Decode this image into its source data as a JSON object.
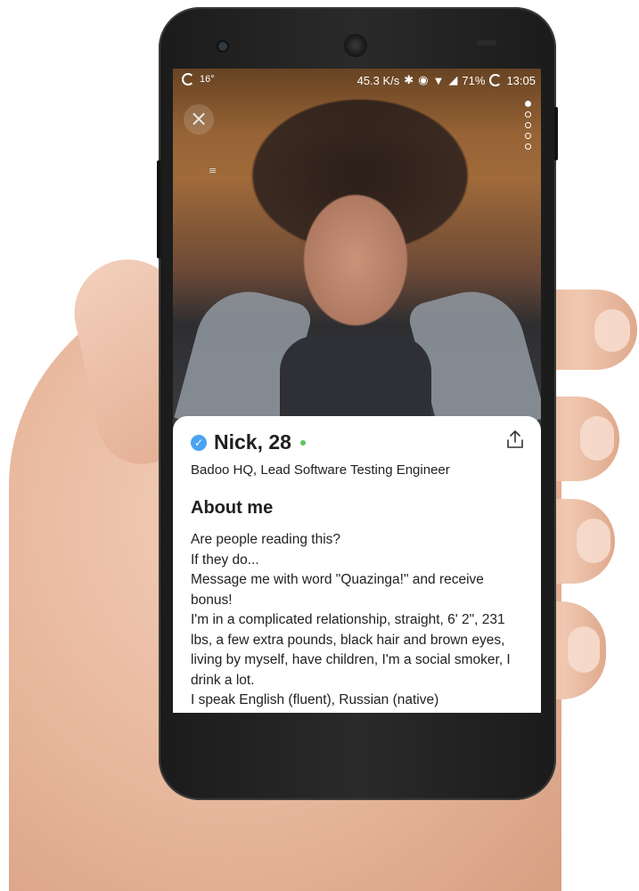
{
  "status_bar": {
    "temperature": "16°",
    "network_speed": "45.3 K/s",
    "battery": "71%",
    "time": "13:05",
    "icons": [
      "bluetooth-icon",
      "data-saver-icon",
      "wifi-icon",
      "signal-icon",
      "battery-ring-icon"
    ]
  },
  "photo": {
    "close_icon": "close-icon",
    "menu_glyph": "≡",
    "pager": {
      "total": 5,
      "active": 0
    }
  },
  "profile": {
    "name": "Nick, 28",
    "verified": true,
    "online": true,
    "job": "Badoo HQ, Lead Software Testing Engineer",
    "share_icon": "share-icon",
    "about_title": "About me",
    "about_lines": [
      "Are people reading this?",
      "If they do...",
      "Message me with word \"Quazinga!\" and receive bonus!",
      "I'm in a complicated relationship, straight, 6' 2\", 231 lbs, a few extra pounds, black hair and brown eyes, living by myself, have children, I'm a social smoker, I drink a lot.",
      "I speak English (fluent), Russian (native)"
    ]
  },
  "colors": {
    "verified_badge": "#4aa3f0",
    "online_dot": "#5cc35c",
    "card_background": "#ffffff",
    "text": "#222222"
  }
}
